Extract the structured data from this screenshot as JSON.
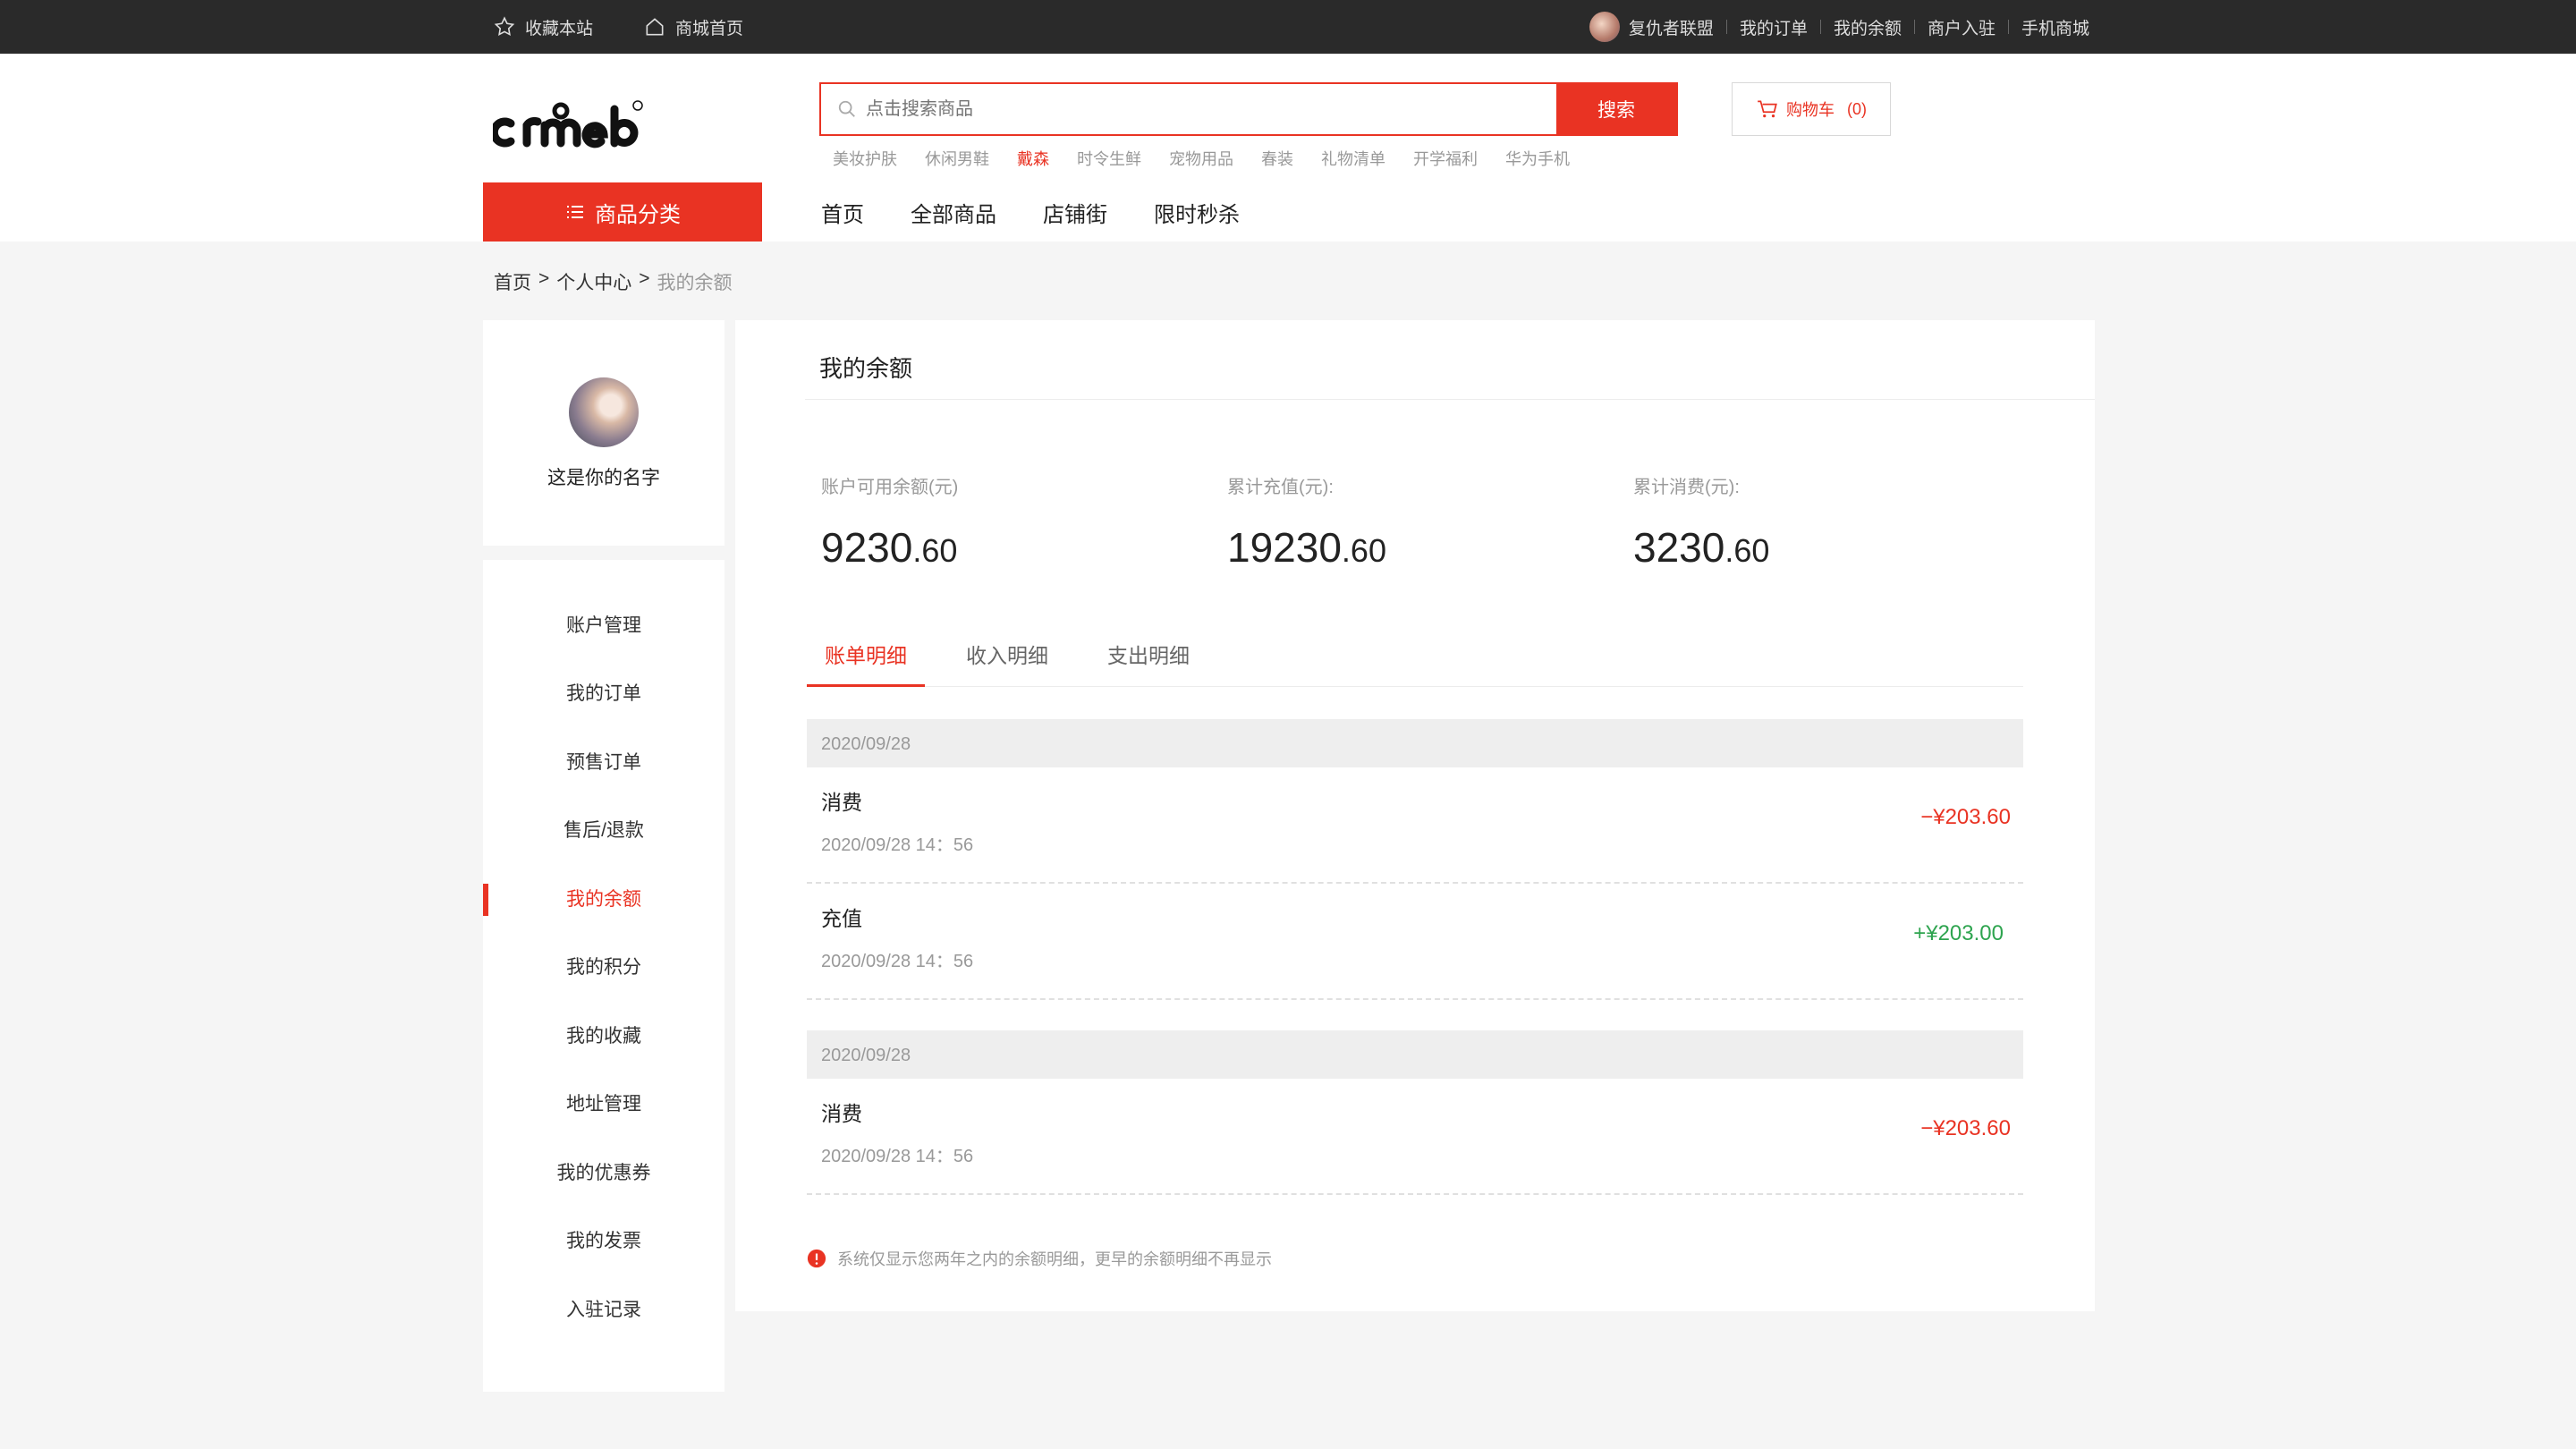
{
  "topbar": {
    "favorite_label": "收藏本站",
    "home_label": "商城首页",
    "username": "复仇者联盟",
    "links": [
      "我的订单",
      "我的余额",
      "商户入驻",
      "手机商城"
    ]
  },
  "header": {
    "search_placeholder": "点击搜索商品",
    "search_button": "搜索",
    "cart_label": "购物车",
    "cart_count": "(0)",
    "hot_words": [
      "美妆护肤",
      "休闲男鞋",
      "戴森",
      "时令生鲜",
      "宠物用品",
      "春装",
      "礼物清单",
      "开学福利",
      "华为手机"
    ],
    "hot_active_index": 2,
    "category_button": "商品分类",
    "nav": [
      "首页",
      "全部商品",
      "店铺街",
      "限时秒杀"
    ]
  },
  "breadcrumb": {
    "home": "首页",
    "sep": ">",
    "center": "个人中心",
    "current": "我的余额"
  },
  "sidebar": {
    "name": "这是你的名字",
    "menu": [
      "账户管理",
      "我的订单",
      "预售订单",
      "售后/退款",
      "我的余额",
      "我的积分",
      "我的收藏",
      "地址管理",
      "我的优惠券",
      "我的发票",
      "入驻记录"
    ],
    "active_index": 4
  },
  "main": {
    "title": "我的余额",
    "stats": [
      {
        "label": "账户可用余额(元)",
        "int": "9230",
        "dec": ".60"
      },
      {
        "label": "累计充值(元):",
        "int": "19230",
        "dec": ".60"
      },
      {
        "label": "累计消费(元):",
        "int": "3230",
        "dec": ".60"
      }
    ],
    "tabs": [
      "账单明细",
      "收入明细",
      "支出明细"
    ],
    "active_tab": 0,
    "groups": [
      {
        "date": "2020/09/28",
        "records": [
          {
            "type": "消费",
            "time": "2020/09/28  14：56",
            "amount": "−¥203.60",
            "sign": "neg"
          },
          {
            "type": "充值",
            "time": "2020/09/28  14：56",
            "amount": "+¥203.00",
            "sign": "pos"
          }
        ]
      },
      {
        "date": "2020/09/28",
        "records": [
          {
            "type": "消费",
            "time": "2020/09/28  14：56",
            "amount": "−¥203.60",
            "sign": "neg"
          }
        ]
      }
    ],
    "notice": "系统仅显示您两年之内的余额明细，更早的余额明细不再显示"
  },
  "colors": {
    "accent": "#e93323",
    "positive": "#2ea44f",
    "topbar": "#2a2a2a"
  }
}
